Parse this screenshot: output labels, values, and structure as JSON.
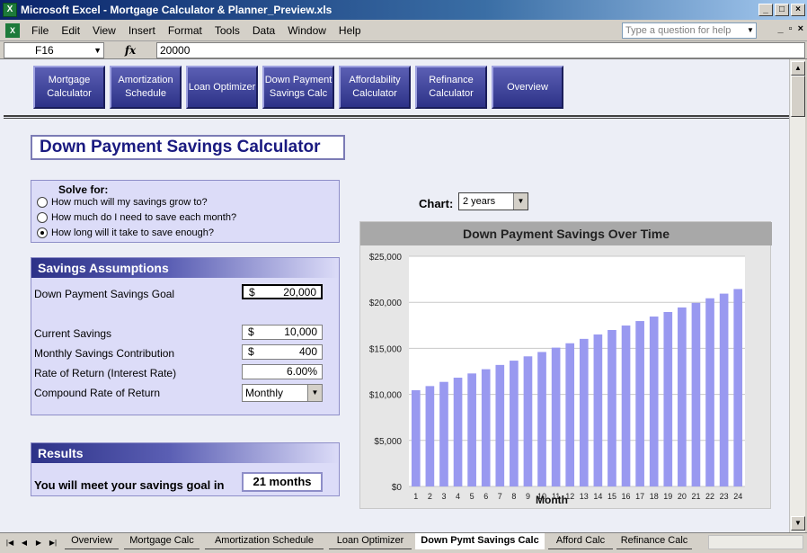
{
  "window": {
    "title": "Microsoft Excel - Mortgage Calculator & Planner_Preview.xls",
    "app_icon": "X"
  },
  "menu": {
    "items": [
      "File",
      "Edit",
      "View",
      "Insert",
      "Format",
      "Tools",
      "Data",
      "Window",
      "Help"
    ],
    "help_placeholder": "Type a question for help"
  },
  "formula_bar": {
    "cell_ref": "F16",
    "fx": "fx",
    "value": "20000"
  },
  "nav_buttons": [
    "Mortgage Calculator",
    "Amortization Schedule",
    "Loan Optimizer",
    "Down Payment Savings Calc",
    "Affordability Calculator",
    "Refinance Calculator",
    "Overview"
  ],
  "page_title": "Down Payment Savings Calculator",
  "solve_for": {
    "title": "Solve for:",
    "options": [
      {
        "label": "How much will my savings grow to?",
        "selected": false
      },
      {
        "label": "How much do I need to save each month?",
        "selected": false
      },
      {
        "label": "How long will it take to save enough?",
        "selected": true
      }
    ]
  },
  "assumptions": {
    "title": "Savings Assumptions",
    "goal_label": "Down Payment Savings Goal",
    "goal_currency": "$",
    "goal_value": "20,000",
    "current_label": "Current Savings",
    "current_currency": "$",
    "current_value": "10,000",
    "monthly_label": "Monthly Savings Contribution",
    "monthly_currency": "$",
    "monthly_value": "400",
    "rate_label": "Rate of Return (Interest Rate)",
    "rate_value": "6.00%",
    "compound_label": "Compound Rate of Return",
    "compound_value": "Monthly"
  },
  "results": {
    "title": "Results",
    "label": "You will meet your savings goal in",
    "value": "21 months"
  },
  "chart_control": {
    "label": "Chart:",
    "value": "2 years"
  },
  "chart_data": {
    "type": "bar",
    "title": "Down Payment Savings Over Time",
    "xlabel": "Month",
    "ylabel": "",
    "ylim": [
      0,
      25000
    ],
    "yticks": [
      0,
      5000,
      10000,
      15000,
      20000,
      25000
    ],
    "ytick_labels": [
      "$0",
      "$5,000",
      "$10,000",
      "$15,000",
      "$20,000",
      "$25,000"
    ],
    "categories": [
      "1",
      "2",
      "3",
      "4",
      "5",
      "6",
      "7",
      "8",
      "9",
      "10",
      "11",
      "12",
      "13",
      "14",
      "15",
      "16",
      "17",
      "18",
      "19",
      "20",
      "21",
      "22",
      "23",
      "24"
    ],
    "values": [
      10450,
      10902,
      11357,
      11814,
      12273,
      12734,
      13198,
      13664,
      14132,
      14603,
      15076,
      15551,
      16029,
      16509,
      16992,
      17477,
      17964,
      18454,
      18946,
      19441,
      19938,
      20438,
      20940,
      21444
    ],
    "color": "#9999f0",
    "grid": true
  },
  "sheet_tabs": [
    "Overview",
    "Mortgage Calc",
    "Amortization Schedule",
    "Loan Optimizer",
    "Down Pymt Savings Calc",
    "Afford Calc",
    "Refinance Calc"
  ],
  "active_tab": "Down Pymt Savings Calc"
}
